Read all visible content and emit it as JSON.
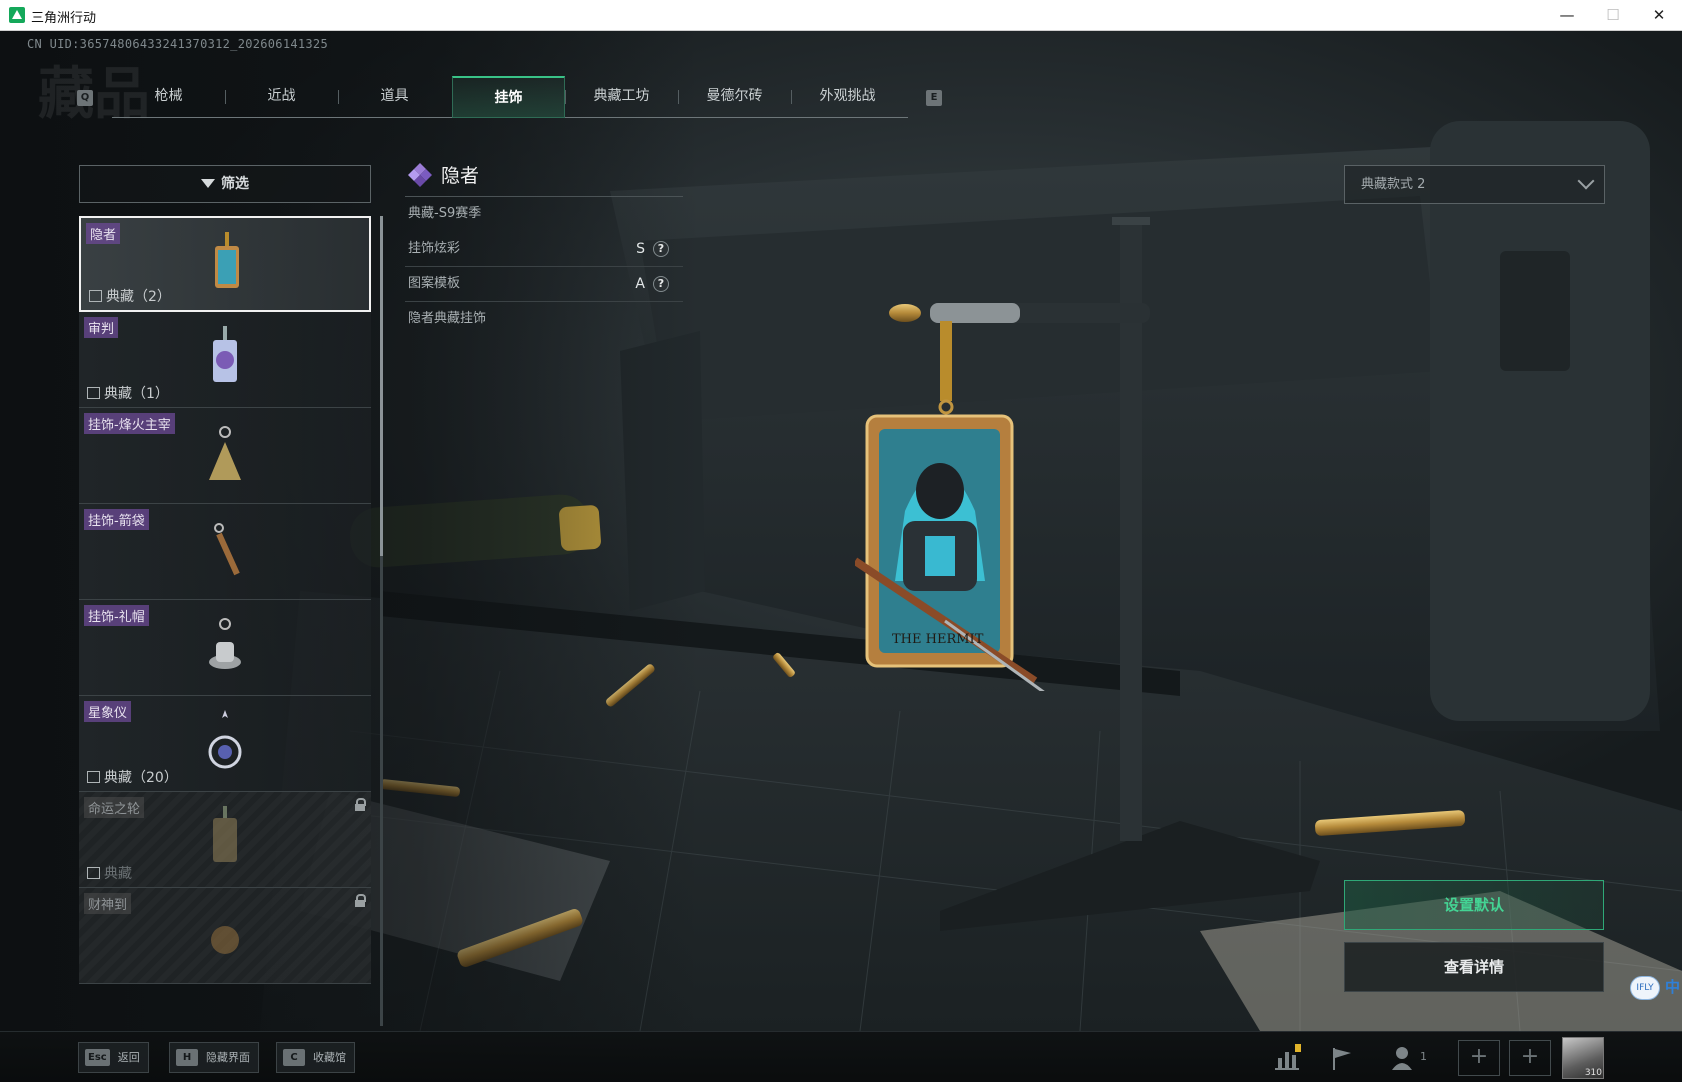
{
  "window": {
    "title": "三角洲行动",
    "minimize": "—",
    "maximize": "☐",
    "close": "✕"
  },
  "uid_text": "CN UID:3657480643324137031‍2_202606141325",
  "page_watermark": "藏品",
  "tabs": {
    "left_key": "Q",
    "right_key": "E",
    "items": [
      {
        "label": "枪械",
        "active": false
      },
      {
        "label": "近战",
        "active": false
      },
      {
        "label": "道具",
        "active": false
      },
      {
        "label": "挂饰",
        "active": true
      },
      {
        "label": "典藏工坊",
        "active": false
      },
      {
        "label": "曼德尔砖",
        "active": false
      },
      {
        "label": "外观挑战",
        "active": false
      }
    ]
  },
  "filter": {
    "label": "筛选",
    "icon": "filter-icon"
  },
  "list": [
    {
      "name": "隐者",
      "count": "典藏（2）",
      "selected": true,
      "locked": false
    },
    {
      "name": "审判",
      "count": "典藏（1）",
      "selected": false,
      "locked": false
    },
    {
      "name": "挂饰-烽火主宰",
      "count": "",
      "selected": false,
      "locked": false
    },
    {
      "name": "挂饰-箭袋",
      "count": "",
      "selected": false,
      "locked": false
    },
    {
      "name": "挂饰-礼帽",
      "count": "",
      "selected": false,
      "locked": false
    },
    {
      "name": "星象仪",
      "count": "典藏（20）",
      "selected": false,
      "locked": false
    },
    {
      "name": "命运之轮",
      "count": "典藏",
      "selected": false,
      "locked": true
    },
    {
      "name": "财神到",
      "count": "",
      "selected": false,
      "locked": true
    }
  ],
  "detail": {
    "title": "隐者",
    "season": "典藏-S9赛季",
    "rows": [
      {
        "label": "挂饰炫彩",
        "grade": "S",
        "help": "?"
      },
      {
        "label": "图案模板",
        "grade": "A",
        "help": "?"
      }
    ],
    "description": "隐者典藏挂饰"
  },
  "style_select": {
    "value": "典藏款式 2"
  },
  "actions": {
    "set_default": "设置默认",
    "view_details": "查看详情"
  },
  "card_text": "THE HERMIT",
  "bottom_hints": [
    {
      "key": "Esc",
      "label": "返回"
    },
    {
      "key": "H",
      "label": "隐藏界面"
    },
    {
      "key": "C",
      "label": "收藏馆"
    }
  ],
  "bottom_status": {
    "squad_count": "1",
    "avatar_level": "310",
    "plus": "+"
  },
  "side_badge": {
    "icon_text": "IFLY",
    "lang": "中"
  },
  "colors": {
    "accent_green": "#39c287",
    "tag_purple": "#6c4a96",
    "background": "#1b2124"
  }
}
